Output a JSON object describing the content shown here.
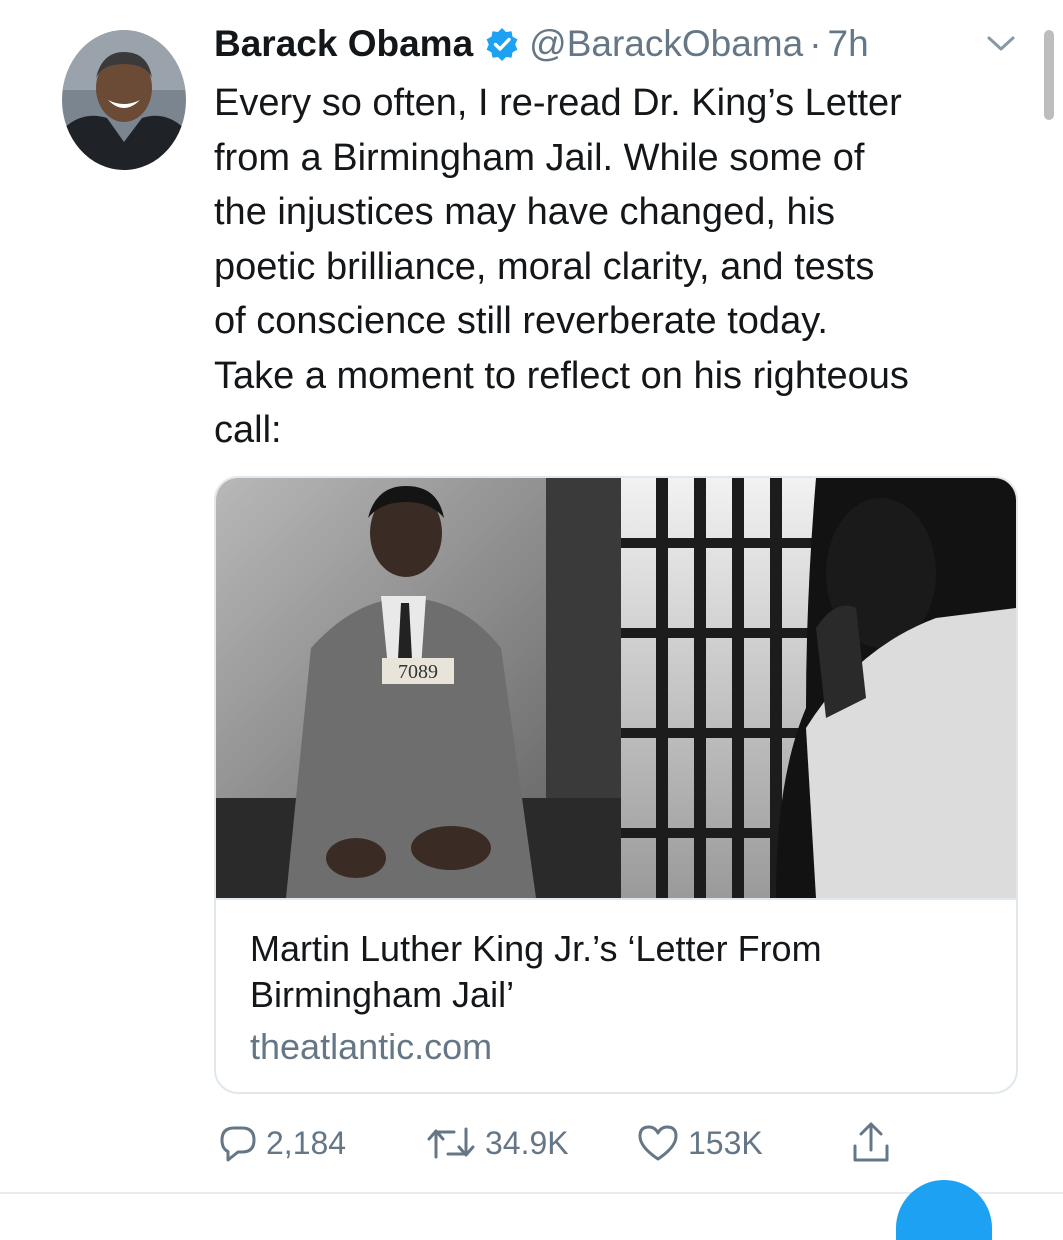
{
  "tweet": {
    "author_name": "Barack Obama",
    "handle": "@BarackObama",
    "separator": "·",
    "time": "7h",
    "text_lines": [
      "Every so often, I re-read Dr. King’s Letter",
      "from a Birmingham Jail. While some of",
      "the injustices may have changed, his",
      "poetic brilliance, moral clarity, and tests",
      "of conscience still reverberate today.",
      "Take a moment to reflect on his righteous",
      "call:"
    ]
  },
  "card": {
    "photo_caption_tag": "7089",
    "title_lines": [
      "Martin Luther King Jr.’s ‘Letter From",
      "Birmingham Jail’"
    ],
    "domain": "theatlantic.com"
  },
  "actions": {
    "reply_count": "2,184",
    "retweet_count": "34.9K",
    "like_count": "153K"
  },
  "icons": {
    "verified": "verified-badge-icon",
    "caret": "chevron-down-icon",
    "reply": "reply-icon",
    "retweet": "retweet-icon",
    "like": "heart-icon",
    "share": "share-icon"
  },
  "colors": {
    "accent": "#1da1f2",
    "secondary_text": "#657786",
    "primary_text": "#14171a",
    "border": "#e1e8ed"
  }
}
